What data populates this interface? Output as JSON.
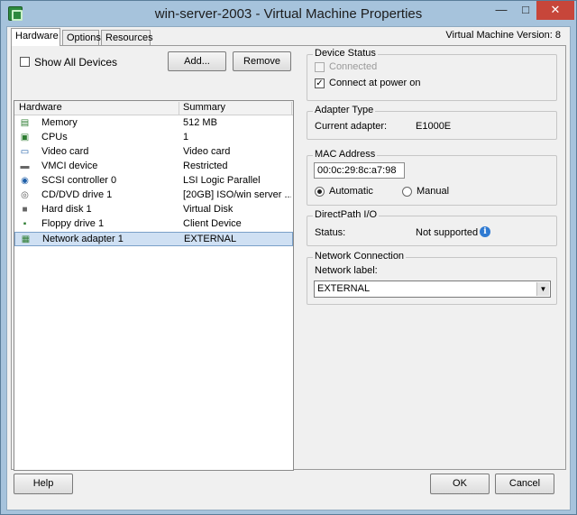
{
  "window": {
    "title": "win-server-2003 - Virtual Machine Properties",
    "app_icon": "vm-properties-icon",
    "minimize_glyph": "—",
    "maximize_glyph": "□",
    "close_glyph": "✕"
  },
  "tabs": [
    {
      "label": "Hardware",
      "active": true
    },
    {
      "label": "Options",
      "active": false
    },
    {
      "label": "Resources",
      "active": false
    }
  ],
  "vm_version": "Virtual Machine Version: 8",
  "hardware_panel": {
    "show_all_devices_label": "Show All Devices",
    "show_all_devices_checked": false,
    "add_button": "Add...",
    "remove_button": "Remove",
    "columns": [
      "Hardware",
      "Summary"
    ],
    "devices": [
      {
        "name": "Memory",
        "summary": "512 MB",
        "icon": "memory-icon",
        "glyph": "▤",
        "color": "#2e7d32"
      },
      {
        "name": "CPUs",
        "summary": "1",
        "icon": "cpu-icon",
        "glyph": "▣",
        "color": "#2e7d32"
      },
      {
        "name": "Video card",
        "summary": "Video card",
        "icon": "video-card-icon",
        "glyph": "▭",
        "color": "#1f5fa8"
      },
      {
        "name": "VMCI device",
        "summary": "Restricted",
        "icon": "vmci-device-icon",
        "glyph": "▬",
        "color": "#666666"
      },
      {
        "name": "SCSI controller 0",
        "summary": "LSI Logic Parallel",
        "icon": "scsi-controller-icon",
        "glyph": "◉",
        "color": "#1f5fa8"
      },
      {
        "name": "CD/DVD drive 1",
        "summary": "[20GB] ISO/win server ...",
        "icon": "cd-dvd-icon",
        "glyph": "◎",
        "color": "#555555"
      },
      {
        "name": "Hard disk 1",
        "summary": "Virtual Disk",
        "icon": "hard-disk-icon",
        "glyph": "■",
        "color": "#666666"
      },
      {
        "name": "Floppy drive 1",
        "summary": "Client Device",
        "icon": "floppy-drive-icon",
        "glyph": "▪",
        "color": "#2e7d32"
      },
      {
        "name": "Network adapter 1",
        "summary": "EXTERNAL",
        "icon": "network-adapter-icon",
        "glyph": "▦",
        "color": "#2e7d32",
        "selected": true
      }
    ]
  },
  "device_status": {
    "title": "Device Status",
    "connected_label": "Connected",
    "connected_checked": false,
    "connected_disabled": true,
    "connect_power_on_label": "Connect at power on",
    "connect_power_on_checked": true,
    "check_glyph": "✓"
  },
  "adapter_type": {
    "title": "Adapter Type",
    "label": "Current adapter:",
    "value": "E1000E"
  },
  "mac_address": {
    "title": "MAC Address",
    "value": "00:0c:29:8c:a7:98",
    "automatic_label": "Automatic",
    "manual_label": "Manual",
    "selected": "Automatic"
  },
  "directpath": {
    "title": "DirectPath I/O",
    "status_label": "Status:",
    "status_value": "Not supported",
    "info_glyph": "i"
  },
  "network_connection": {
    "title": "Network Connection",
    "label": "Network label:",
    "value": "EXTERNAL",
    "arrow_glyph": "▼"
  },
  "footer": {
    "help_button": "Help",
    "ok_button": "OK",
    "cancel_button": "Cancel"
  }
}
